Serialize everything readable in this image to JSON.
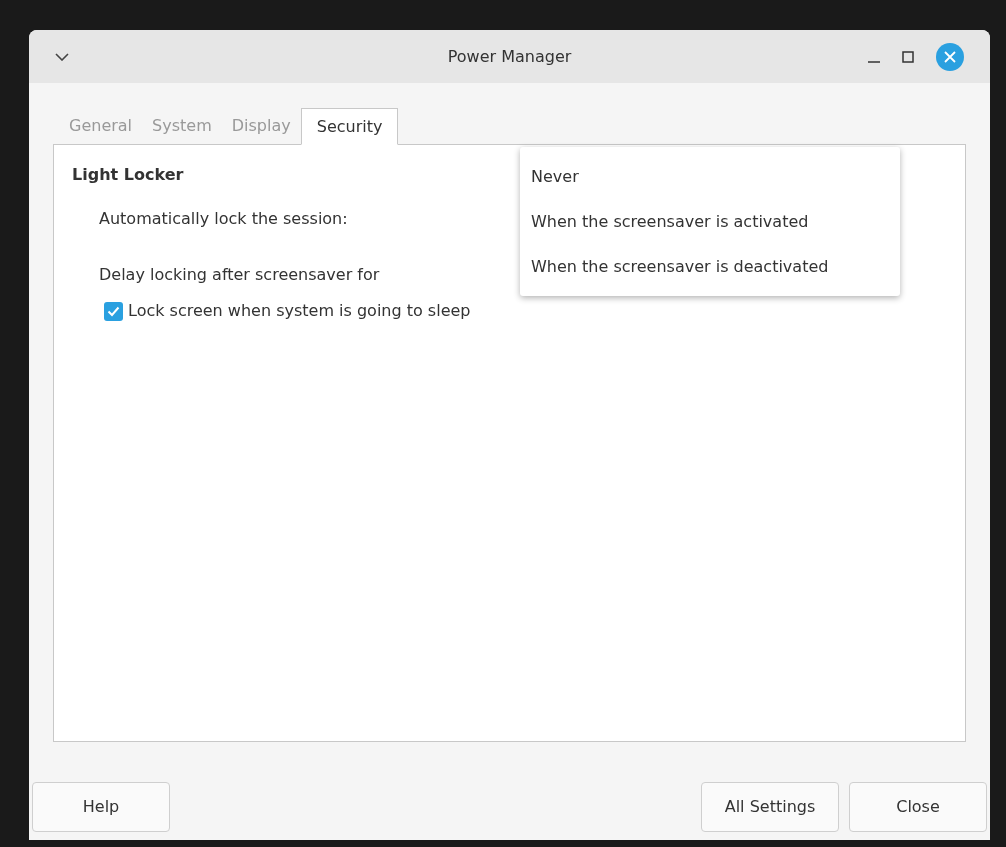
{
  "window": {
    "title": "Power Manager"
  },
  "tabs": [
    {
      "label": "General",
      "selected": false
    },
    {
      "label": "System",
      "selected": false
    },
    {
      "label": "Display",
      "selected": false
    },
    {
      "label": "Security",
      "selected": true
    }
  ],
  "section": {
    "title": "Light Locker",
    "rows": [
      {
        "kind": "label",
        "label": "Automatically lock the session:"
      },
      {
        "kind": "label",
        "label": "Delay locking after screensaver for"
      },
      {
        "kind": "checkbox",
        "label": "Lock screen when system is going to sleep",
        "checked": true
      }
    ]
  },
  "dropdown_menu": {
    "items": [
      {
        "label": "Never"
      },
      {
        "label": "When the screensaver is activated"
      },
      {
        "label": "When the screensaver is deactivated"
      }
    ]
  },
  "buttons": {
    "left": [
      "Help"
    ],
    "right": [
      "All Settings",
      "Close"
    ]
  }
}
